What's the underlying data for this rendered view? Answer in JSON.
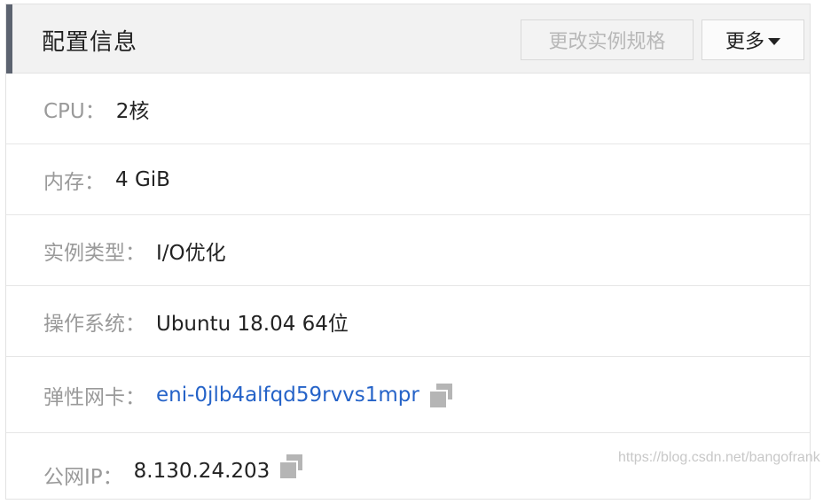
{
  "header": {
    "title": "配置信息",
    "change_spec_label": "更改实例规格",
    "more_label": "更多"
  },
  "rows": [
    {
      "label": "CPU：",
      "value": "2核"
    },
    {
      "label": "内存：",
      "value": "4 GiB"
    },
    {
      "label": "实例类型：",
      "value": "I/O优化"
    },
    {
      "label": "操作系统：",
      "value": "Ubuntu 18.04 64位"
    },
    {
      "label": "弹性网卡：",
      "value": "eni-0jlb4alfqd59rvvs1mpr"
    },
    {
      "label": "公网IP：",
      "value": "8.130.24.203"
    }
  ],
  "watermark": "https://blog.csdn.net/bangofrank",
  "colors": {
    "accent": "#5c6370",
    "link": "#2563c8",
    "label": "#9a9a9a"
  }
}
